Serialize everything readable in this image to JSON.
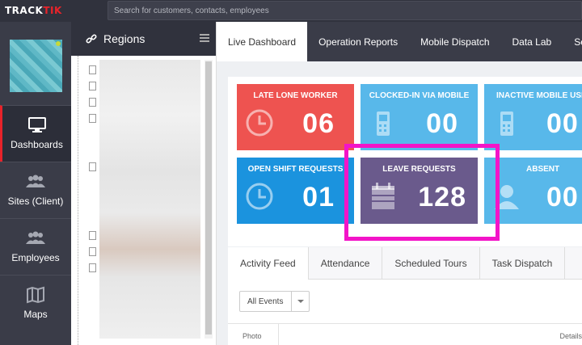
{
  "brand": {
    "part1": "TRACK",
    "part2": "TIK"
  },
  "search": {
    "placeholder": "Search for customers, contacts, employees"
  },
  "nav": [
    {
      "label": "Dashboards",
      "icon": "monitor-icon"
    },
    {
      "label": "Sites (Client)",
      "icon": "people-icon"
    },
    {
      "label": "Employees",
      "icon": "people-icon"
    },
    {
      "label": "Maps",
      "icon": "map-icon"
    }
  ],
  "tree": {
    "title": "Regions"
  },
  "tabs": [
    "Live Dashboard",
    "Operation Reports",
    "Mobile Dispatch",
    "Data Lab",
    "Setti"
  ],
  "tiles": [
    {
      "title": "LATE LONE WORKER",
      "value": "06",
      "color": "#ee5350",
      "icon": "clock-icon"
    },
    {
      "title": "CLOCKED-IN VIA MOBILE",
      "value": "00",
      "color": "#58b8ea",
      "icon": "phone-icon"
    },
    {
      "title": "INACTIVE MOBILE USE",
      "value": "00",
      "color": "#58b8ea",
      "icon": "phone-icon"
    },
    {
      "title": "OPEN SHIFT REQUESTS",
      "value": "01",
      "color": "#1b93de",
      "icon": "clock-icon"
    },
    {
      "title": "LEAVE REQUESTS",
      "value": "128",
      "color": "#6a5a8c",
      "icon": "calendar-icon"
    },
    {
      "title": "ABSENT",
      "value": "00",
      "color": "#58b8ea",
      "icon": "person-icon"
    }
  ],
  "feed": {
    "tabs": [
      "Activity Feed",
      "Attendance",
      "Scheduled Tours",
      "Task Dispatch"
    ],
    "filter": "All Events",
    "columns": {
      "photo": "Photo",
      "details": "Details"
    }
  }
}
